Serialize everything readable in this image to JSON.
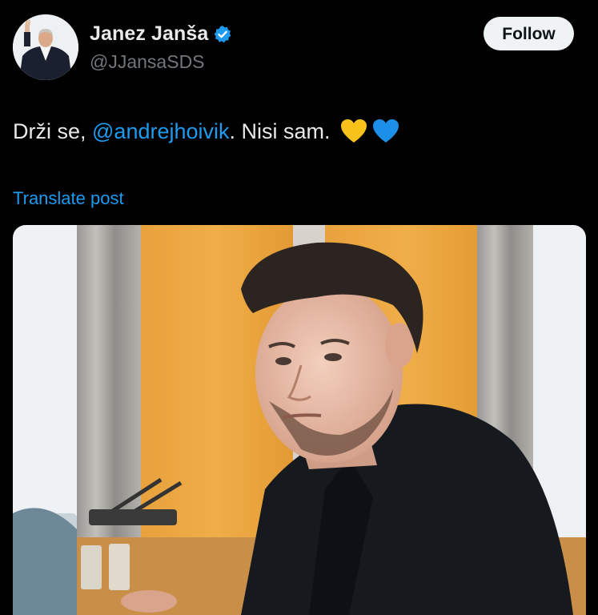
{
  "author": {
    "display_name": "Janez Janša",
    "handle": "@JJansaSDS",
    "verified": true,
    "avatar_icon": "profile-photo-icon"
  },
  "actions": {
    "follow_label": "Follow"
  },
  "post": {
    "text_before": "Drži se, ",
    "mention": "@andrejhoivik",
    "text_after": ". Nisi sam.",
    "emojis": [
      "yellow-heart-icon",
      "blue-heart-icon"
    ],
    "translate_label": "Translate post"
  },
  "media": {
    "icon": "photo-man-in-meeting-room"
  },
  "colors": {
    "background": "#000000",
    "text": "#e7e9ea",
    "secondary": "#71767b",
    "link": "#1d9bf0",
    "follow_bg": "#eff3f4",
    "verified": "#1d9bf0",
    "yellow_heart": "#f7c31a",
    "blue_heart": "#1c8fe8"
  }
}
